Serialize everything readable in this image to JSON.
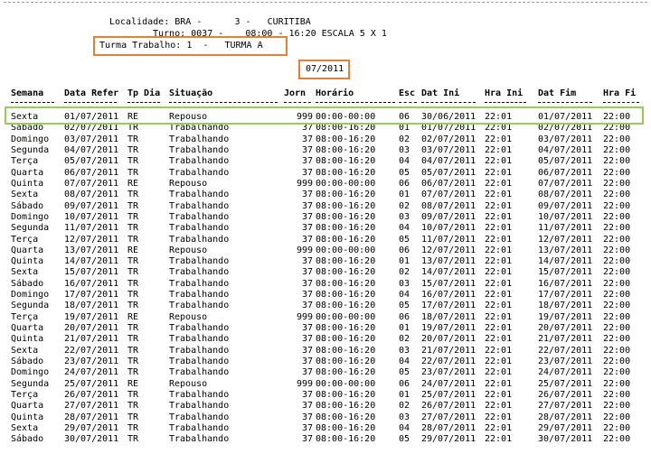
{
  "header": {
    "localidade_line": "Localidade: BRA -      3 -   CURITIBA",
    "turno_line": "Turno: 0037 -    08:00 - 16:20 ESCALA 5 X 1",
    "turma_line": "Turma Trabalho: 1  -   TURMA A",
    "period": "07/2011"
  },
  "colors": {
    "highlight_orange": "#ed7d31",
    "highlight_green": "#92d050"
  },
  "table": {
    "columns": [
      "Semana",
      "Data Refer",
      "Tp Dia",
      "Situação",
      "Jorn",
      "Horário",
      "Esc",
      "Dat Ini",
      "Hra Ini",
      "Dat Fim",
      "Hra Fi"
    ],
    "rows": [
      [
        "Sexta",
        "01/07/2011",
        "RE",
        "Repouso",
        "999",
        "00:00-00:00",
        "06",
        "30/06/2011",
        "22:01",
        "01/07/2011",
        "22:00"
      ],
      [
        "Sábado",
        "02/07/2011",
        "TR",
        "Trabalhando",
        "37",
        "08:00-16:20",
        "01",
        "01/07/2011",
        "22:01",
        "02/07/2011",
        "22:00"
      ],
      [
        "Domingo",
        "03/07/2011",
        "TR",
        "Trabalhando",
        "37",
        "08:00-16:20",
        "02",
        "02/07/2011",
        "22:01",
        "03/07/2011",
        "22:00"
      ],
      [
        "Segunda",
        "04/07/2011",
        "TR",
        "Trabalhando",
        "37",
        "08:00-16:20",
        "03",
        "03/07/2011",
        "22:01",
        "04/07/2011",
        "22:00"
      ],
      [
        "Terça",
        "05/07/2011",
        "TR",
        "Trabalhando",
        "37",
        "08:00-16:20",
        "04",
        "04/07/2011",
        "22:01",
        "05/07/2011",
        "22:00"
      ],
      [
        "Quarta",
        "06/07/2011",
        "TR",
        "Trabalhando",
        "37",
        "08:00-16:20",
        "05",
        "05/07/2011",
        "22:01",
        "06/07/2011",
        "22:00"
      ],
      [
        "Quinta",
        "07/07/2011",
        "RE",
        "Repouso",
        "999",
        "00:00-00:00",
        "06",
        "06/07/2011",
        "22:01",
        "07/07/2011",
        "22:00"
      ],
      [
        "Sexta",
        "08/07/2011",
        "TR",
        "Trabalhando",
        "37",
        "08:00-16:20",
        "01",
        "07/07/2011",
        "22:01",
        "08/07/2011",
        "22:00"
      ],
      [
        "Sábado",
        "09/07/2011",
        "TR",
        "Trabalhando",
        "37",
        "08:00-16:20",
        "02",
        "08/07/2011",
        "22:01",
        "09/07/2011",
        "22:00"
      ],
      [
        "Domingo",
        "10/07/2011",
        "TR",
        "Trabalhando",
        "37",
        "08:00-16:20",
        "03",
        "09/07/2011",
        "22:01",
        "10/07/2011",
        "22:00"
      ],
      [
        "Segunda",
        "11/07/2011",
        "TR",
        "Trabalhando",
        "37",
        "08:00-16:20",
        "04",
        "10/07/2011",
        "22:01",
        "11/07/2011",
        "22:00"
      ],
      [
        "Terça",
        "12/07/2011",
        "TR",
        "Trabalhando",
        "37",
        "08:00-16:20",
        "05",
        "11/07/2011",
        "22:01",
        "12/07/2011",
        "22:00"
      ],
      [
        "Quarta",
        "13/07/2011",
        "RE",
        "Repouso",
        "999",
        "00:00-00:00",
        "06",
        "12/07/2011",
        "22:01",
        "13/07/2011",
        "22:00"
      ],
      [
        "Quinta",
        "14/07/2011",
        "TR",
        "Trabalhando",
        "37",
        "08:00-16:20",
        "01",
        "13/07/2011",
        "22:01",
        "14/07/2011",
        "22:00"
      ],
      [
        "Sexta",
        "15/07/2011",
        "TR",
        "Trabalhando",
        "37",
        "08:00-16:20",
        "02",
        "14/07/2011",
        "22:01",
        "15/07/2011",
        "22:00"
      ],
      [
        "Sábado",
        "16/07/2011",
        "TR",
        "Trabalhando",
        "37",
        "08:00-16:20",
        "03",
        "15/07/2011",
        "22:01",
        "16/07/2011",
        "22:00"
      ],
      [
        "Domingo",
        "17/07/2011",
        "TR",
        "Trabalhando",
        "37",
        "08:00-16:20",
        "04",
        "16/07/2011",
        "22:01",
        "17/07/2011",
        "22:00"
      ],
      [
        "Segunda",
        "18/07/2011",
        "TR",
        "Trabalhando",
        "37",
        "08:00-16:20",
        "05",
        "17/07/2011",
        "22:01",
        "18/07/2011",
        "22:00"
      ],
      [
        "Terça",
        "19/07/2011",
        "RE",
        "Repouso",
        "999",
        "00:00-00:00",
        "06",
        "18/07/2011",
        "22:01",
        "19/07/2011",
        "22:00"
      ],
      [
        "Quarta",
        "20/07/2011",
        "TR",
        "Trabalhando",
        "37",
        "08:00-16:20",
        "01",
        "19/07/2011",
        "22:01",
        "20/07/2011",
        "22:00"
      ],
      [
        "Quinta",
        "21/07/2011",
        "TR",
        "Trabalhando",
        "37",
        "08:00-16:20",
        "02",
        "20/07/2011",
        "22:01",
        "21/07/2011",
        "22:00"
      ],
      [
        "Sexta",
        "22/07/2011",
        "TR",
        "Trabalhando",
        "37",
        "08:00-16:20",
        "03",
        "21/07/2011",
        "22:01",
        "22/07/2011",
        "22:00"
      ],
      [
        "Sábado",
        "23/07/2011",
        "TR",
        "Trabalhando",
        "37",
        "08:00-16:20",
        "04",
        "22/07/2011",
        "22:01",
        "23/07/2011",
        "22:00"
      ],
      [
        "Domingo",
        "24/07/2011",
        "TR",
        "Trabalhando",
        "37",
        "08:00-16:20",
        "05",
        "23/07/2011",
        "22:01",
        "24/07/2011",
        "22:00"
      ],
      [
        "Segunda",
        "25/07/2011",
        "RE",
        "Repouso",
        "999",
        "00:00-00:00",
        "06",
        "24/07/2011",
        "22:01",
        "25/07/2011",
        "22:00"
      ],
      [
        "Terça",
        "26/07/2011",
        "TR",
        "Trabalhando",
        "37",
        "08:00-16:20",
        "01",
        "25/07/2011",
        "22:01",
        "26/07/2011",
        "22:00"
      ],
      [
        "Quarta",
        "27/07/2011",
        "TR",
        "Trabalhando",
        "37",
        "08:00-16:20",
        "02",
        "26/07/2011",
        "22:01",
        "27/07/2011",
        "22:00"
      ],
      [
        "Quinta",
        "28/07/2011",
        "TR",
        "Trabalhando",
        "37",
        "08:00-16:20",
        "03",
        "27/07/2011",
        "22:01",
        "28/07/2011",
        "22:00"
      ],
      [
        "Sexta",
        "29/07/2011",
        "TR",
        "Trabalhando",
        "37",
        "08:00-16:20",
        "04",
        "28/07/2011",
        "22:01",
        "29/07/2011",
        "22:00"
      ],
      [
        "Sábado",
        "30/07/2011",
        "TR",
        "Trabalhando",
        "37",
        "08:00-16:20",
        "05",
        "29/07/2011",
        "22:01",
        "30/07/2011",
        "22:00"
      ]
    ]
  }
}
